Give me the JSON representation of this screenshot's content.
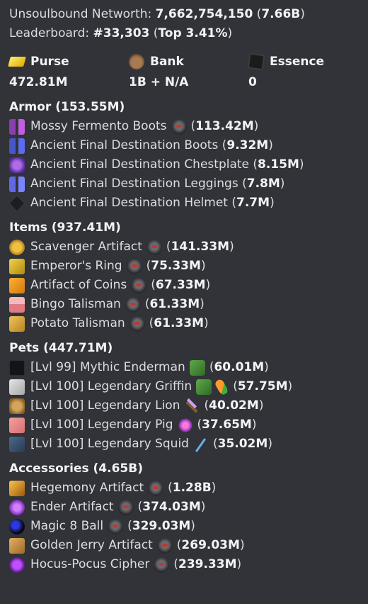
{
  "header": {
    "networth_label": "Unsoulbound Networth: ",
    "networth_value": "7,662,754,150",
    "networth_short": "7.66B",
    "leaderboard_label": "Leaderboard: ",
    "leaderboard_rank": "#33,303",
    "leaderboard_top": "Top 3.41%"
  },
  "stats": [
    {
      "label": "Purse",
      "value": "472.81M",
      "icon": "gold-ingot-icon"
    },
    {
      "label": "Bank",
      "value": "1B + N/A",
      "icon": "bank-bag-icon"
    },
    {
      "label": "Essence",
      "value": "0",
      "icon": "essence-icon"
    }
  ],
  "sections": {
    "armor": {
      "title": "Armor (153.55M)",
      "items": [
        {
          "name": "Mossy Fermento Boots",
          "value": "113.42M",
          "spider": true
        },
        {
          "name": "Ancient Final Destination Boots",
          "value": "9.32M",
          "spider": false
        },
        {
          "name": "Ancient Final Destination Chestplate",
          "value": "8.15M",
          "spider": false
        },
        {
          "name": "Ancient Final Destination Leggings",
          "value": "7.8M",
          "spider": false
        },
        {
          "name": "Ancient Final Destination Helmet",
          "value": "7.7M",
          "spider": false
        }
      ]
    },
    "items": {
      "title": "Items (937.41M)",
      "items": [
        {
          "name": "Scavenger Artifact",
          "value": "141.33M"
        },
        {
          "name": "Emperor's Ring",
          "value": "75.33M"
        },
        {
          "name": "Artifact of Coins",
          "value": "67.33M"
        },
        {
          "name": "Bingo Talisman",
          "value": "61.33M"
        },
        {
          "name": "Potato Talisman",
          "value": "61.33M"
        }
      ]
    },
    "pets": {
      "title": "Pets (447.71M)",
      "items": [
        {
          "name": "[Lvl 99] Mythic Enderman",
          "value": "60.01M"
        },
        {
          "name": "[Lvl 100] Legendary Griffin",
          "value": "57.75M"
        },
        {
          "name": "[Lvl 100] Legendary Lion",
          "value": "40.02M"
        },
        {
          "name": "[Lvl 100] Legendary Pig",
          "value": "37.65M"
        },
        {
          "name": "[Lvl 100] Legendary Squid",
          "value": "35.02M"
        }
      ]
    },
    "accessories": {
      "title": "Accessories (4.65B)",
      "items": [
        {
          "name": "Hegemony Artifact",
          "value": "1.28B"
        },
        {
          "name": "Ender Artifact",
          "value": "374.03M"
        },
        {
          "name": "Magic 8 Ball",
          "value": "329.03M"
        },
        {
          "name": "Golden Jerry Artifact",
          "value": "269.03M"
        },
        {
          "name": "Hocus-Pocus Cipher",
          "value": "239.33M"
        }
      ]
    }
  }
}
